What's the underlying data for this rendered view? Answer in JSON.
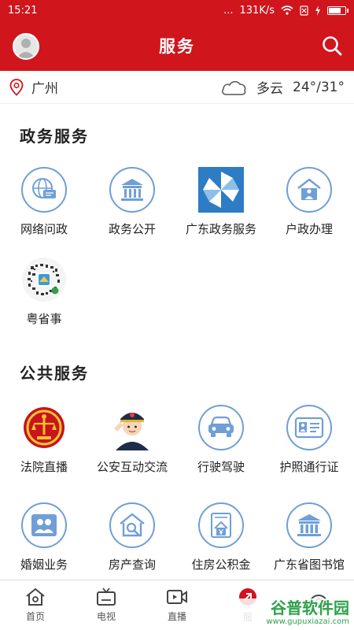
{
  "status_bar": {
    "time": "15:21",
    "signal": "...",
    "speed": "131K/s"
  },
  "header": {
    "title": "服务"
  },
  "location": {
    "city": "广州",
    "weather": "多云",
    "temperature": "24°/31°"
  },
  "sections": [
    {
      "title": "政务服务",
      "items": [
        {
          "label": "网络问政",
          "icon": "chat-globe-icon"
        },
        {
          "label": "政务公开",
          "icon": "government-building-icon"
        },
        {
          "label": "广东政务服务",
          "icon": "guangdong-gov-logo-icon"
        },
        {
          "label": "户政办理",
          "icon": "household-person-icon"
        },
        {
          "label": "粤省事",
          "icon": "qr-code-icon"
        }
      ]
    },
    {
      "title": "公共服务",
      "items": [
        {
          "label": "法院直播",
          "icon": "court-emblem-icon"
        },
        {
          "label": "公安互动交流",
          "icon": "police-officer-icon"
        },
        {
          "label": "行驶驾驶",
          "icon": "car-icon"
        },
        {
          "label": "护照通行证",
          "icon": "id-card-icon"
        },
        {
          "label": "婚姻业务",
          "icon": "couple-photo-icon"
        },
        {
          "label": "房产查询",
          "icon": "house-search-icon"
        },
        {
          "label": "住房公积金",
          "icon": "housing-fund-icon"
        },
        {
          "label": "广东省图书馆",
          "icon": "library-building-icon"
        }
      ]
    }
  ],
  "tabs": [
    {
      "label": "首页",
      "icon": "home-icon"
    },
    {
      "label": "电视",
      "icon": "tv-icon"
    },
    {
      "label": "直播",
      "icon": "live-video-icon"
    },
    {
      "label": "服",
      "icon": "service-icon"
    },
    {
      "label": "",
      "icon": "mine-icon"
    }
  ],
  "watermark": {
    "brand": "谷普软件园",
    "url": "www.gupuxiazai.com"
  },
  "colors": {
    "brand_red": "#d0151d",
    "icon_blue": "#6f9fd6"
  }
}
